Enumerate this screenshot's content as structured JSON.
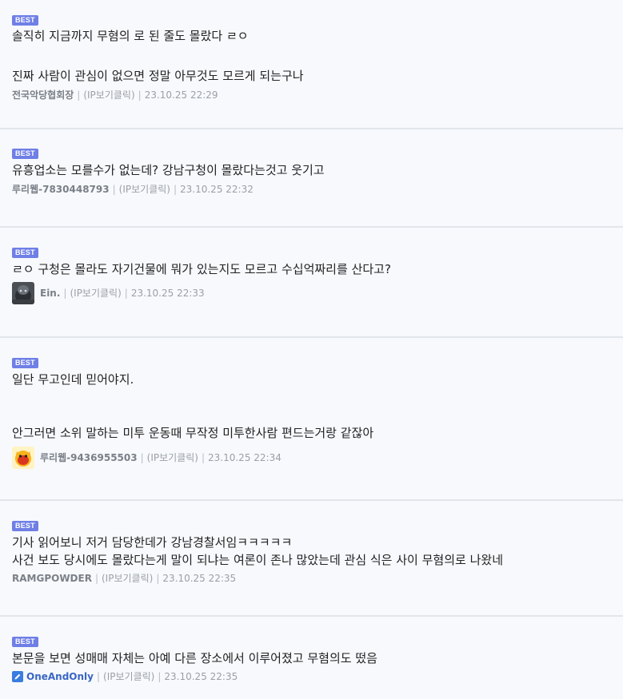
{
  "badge_label": "BEST",
  "ip_label": "(IP보기클릭)",
  "meta_separator": "|",
  "comments": [
    {
      "lines": [
        "솔직히 지금까지 무혐의 로 된 줄도 몰랐다 ㄹㅇ",
        "진짜 사람이 관심이 없으면 정말 아무것도 모르게 되는구나"
      ],
      "author": "전국악당협회장",
      "date": "23.10.25 22:29"
    },
    {
      "lines": [
        "유흥업소는 모를수가 없는데? 강남구청이 몰랐다는것고 웃기고"
      ],
      "author": "루리웹-7830448793",
      "date": "23.10.25 22:32"
    },
    {
      "lines": [
        "ㄹㅇ 구청은 몰라도 자기건물에 뭐가 있는지도 모르고 수십억짜리를 산다고?"
      ],
      "author": "Ein.",
      "date": "23.10.25 22:33"
    },
    {
      "lines": [
        "일단 무고인데 믿어야지.",
        "안그러면 소위 말하는 미투 운동때 무작정 미투한사람 편드는거랑 같잖아"
      ],
      "author": "루리웹-9436955503",
      "date": "23.10.25 22:34"
    },
    {
      "lines": [
        "기사 읽어보니 저거 담당한데가 강남경찰서임ㅋㅋㅋㅋㅋ",
        "사건 보도 당시에도 몰랐다는게 말이 되냐는 여론이 존나 많았는데 관심 식은 사이 무혐의로 나왔네"
      ],
      "author": "RAMGPOWDER",
      "date": "23.10.25 22:35"
    },
    {
      "lines": [
        "본문을 보면 성매매 자체는 아예 다른 장소에서 이루어졌고 무혐의도 떴음"
      ],
      "author": "OneAndOnly",
      "date": "23.10.25 22:35"
    }
  ]
}
